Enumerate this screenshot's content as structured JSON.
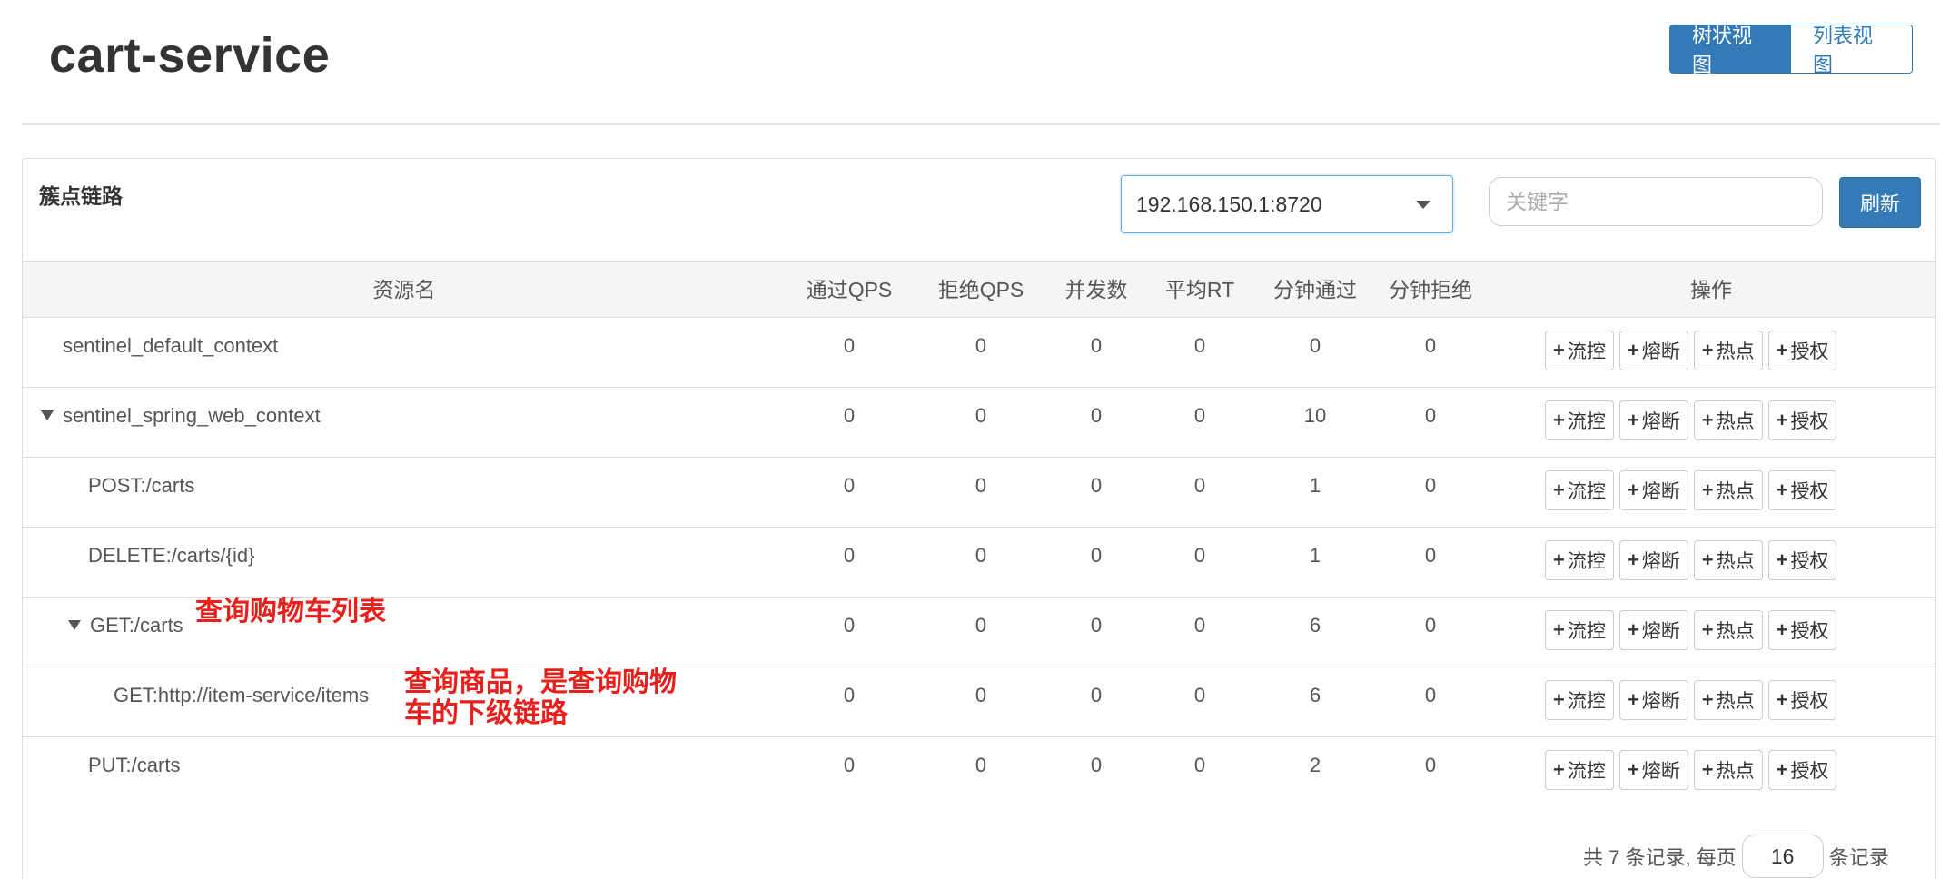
{
  "header": {
    "title": "cart-service",
    "tree_view_label": "树状视图",
    "list_view_label": "列表视图"
  },
  "panel": {
    "title": "簇点链路",
    "machine_selected": "192.168.150.1:8720",
    "keyword_placeholder": "关键字",
    "refresh_label": "刷新"
  },
  "table": {
    "columns": [
      "资源名",
      "通过QPS",
      "拒绝QPS",
      "并发数",
      "平均RT",
      "分钟通过",
      "分钟拒绝",
      "操作"
    ],
    "rows": [
      {
        "name": "sentinel_default_context",
        "expandable": false,
        "pass_qps": "0",
        "block_qps": "0",
        "concurrency": "0",
        "avg_rt": "0",
        "minute_pass": "0",
        "minute_block": "0"
      },
      {
        "name": "sentinel_spring_web_context",
        "expandable": true,
        "pass_qps": "0",
        "block_qps": "0",
        "concurrency": "0",
        "avg_rt": "0",
        "minute_pass": "10",
        "minute_block": "0"
      },
      {
        "name": "POST:/carts",
        "expandable": false,
        "pass_qps": "0",
        "block_qps": "0",
        "concurrency": "0",
        "avg_rt": "0",
        "minute_pass": "1",
        "minute_block": "0"
      },
      {
        "name": "DELETE:/carts/{id}",
        "expandable": false,
        "pass_qps": "0",
        "block_qps": "0",
        "concurrency": "0",
        "avg_rt": "0",
        "minute_pass": "1",
        "minute_block": "0"
      },
      {
        "name": "GET:/carts",
        "expandable": true,
        "pass_qps": "0",
        "block_qps": "0",
        "concurrency": "0",
        "avg_rt": "0",
        "minute_pass": "6",
        "minute_block": "0"
      },
      {
        "name": "GET:http://item-service/items",
        "expandable": false,
        "pass_qps": "0",
        "block_qps": "0",
        "concurrency": "0",
        "avg_rt": "0",
        "minute_pass": "6",
        "minute_block": "0"
      },
      {
        "name": "PUT:/carts",
        "expandable": false,
        "pass_qps": "0",
        "block_qps": "0",
        "concurrency": "0",
        "avg_rt": "0",
        "minute_pass": "2",
        "minute_block": "0"
      }
    ],
    "actions": [
      "流控",
      "熔断",
      "热点",
      "授权"
    ]
  },
  "annotations": {
    "get_carts": "查询购物车列表",
    "items_line1": "查询商品，是查询购物",
    "items_line2": "车的下级链路"
  },
  "pager": {
    "prefix": "共 7 条记录, 每页",
    "page_size": "16",
    "suffix": "条记录"
  },
  "colors": {
    "primary": "#337ab7",
    "annotation": "#e8201c"
  }
}
